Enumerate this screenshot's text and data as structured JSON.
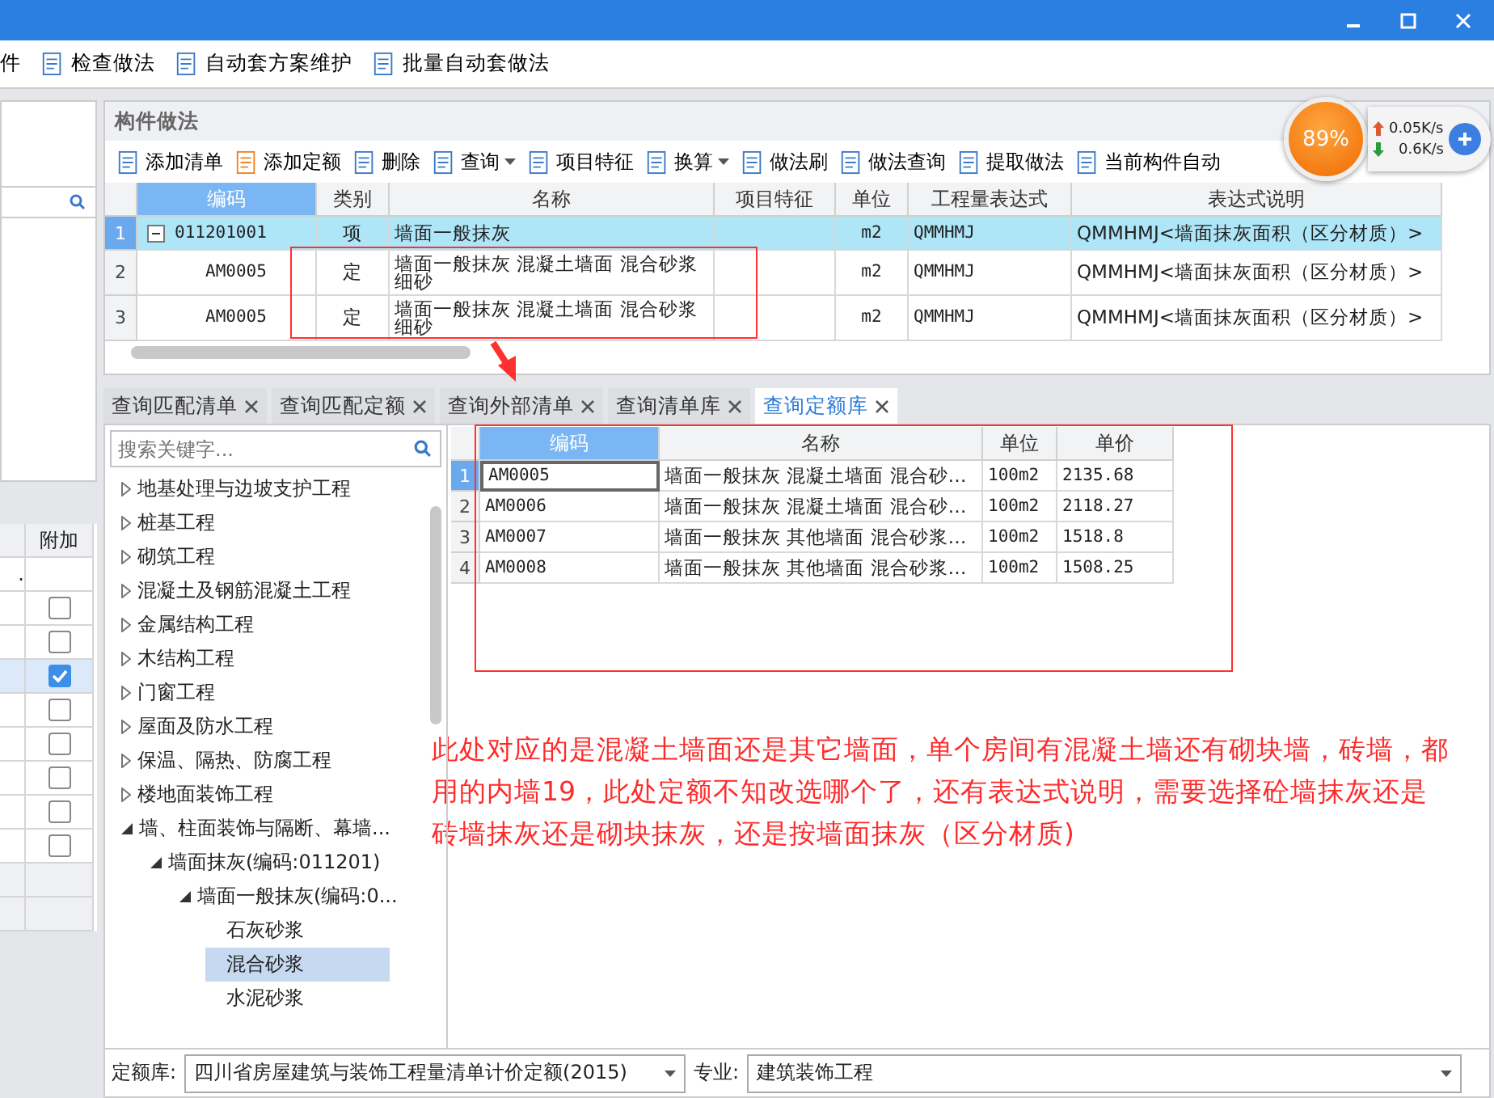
{
  "toolbar": {
    "cut_label": "件",
    "buttons": [
      "检查做法",
      "自动套方案维护",
      "批量自动套做法"
    ]
  },
  "left_panel": {
    "column": "附加",
    "rows": [
      {
        "kind": "text",
        "text": "."
      },
      {
        "kind": "checkbox",
        "checked": false
      },
      {
        "kind": "checkbox",
        "checked": false
      },
      {
        "kind": "checkbox",
        "checked": true
      },
      {
        "kind": "checkbox",
        "checked": false
      },
      {
        "kind": "checkbox",
        "checked": false
      },
      {
        "kind": "checkbox",
        "checked": false
      },
      {
        "kind": "checkbox",
        "checked": false
      },
      {
        "kind": "checkbox",
        "checked": false
      },
      {
        "kind": "blank"
      },
      {
        "kind": "blank"
      }
    ]
  },
  "method_panel": {
    "title": "构件做法",
    "toolbar": [
      {
        "label": "添加清单",
        "dropdown": false
      },
      {
        "label": "添加定额",
        "dropdown": false
      },
      {
        "label": "删除",
        "dropdown": false
      },
      {
        "label": "查询",
        "dropdown": true
      },
      {
        "label": "项目特征",
        "dropdown": false
      },
      {
        "label": "换算",
        "dropdown": true
      },
      {
        "label": "做法刷",
        "dropdown": false
      },
      {
        "label": "做法查询",
        "dropdown": false
      },
      {
        "label": "提取做法",
        "dropdown": false
      },
      {
        "label": "当前构件自动",
        "dropdown": false
      }
    ],
    "columns": [
      "编码",
      "类别",
      "名称",
      "项目特征",
      "单位",
      "工程量表达式",
      "表达式说明"
    ],
    "rows": [
      {
        "number": "1",
        "code": "011201001",
        "type": "项",
        "name": "墙面一般抹灰",
        "unit": "m2",
        "expression": "QMMHMJ",
        "description": "QMMHMJ<墙面抹灰面积（区分材质）>",
        "selected": true,
        "expanded": true,
        "children": [
          {
            "number": "2",
            "code": "AM0005",
            "type": "定",
            "name": "墙面一般抹灰 混凝土墙面 混合砂浆细砂",
            "unit": "m2",
            "expression": "QMMHMJ",
            "description": "QMMHMJ<墙面抹灰面积（区分材质）>",
            "selected": false
          },
          {
            "number": "3",
            "code": "AM0005",
            "type": "定",
            "name": "墙面一般抹灰 混凝土墙面 混合砂浆细砂",
            "unit": "m2",
            "expression": "QMMHMJ",
            "description": "QMMHMJ<墙面抹灰面积（区分材质）>",
            "selected": false
          }
        ]
      }
    ]
  },
  "tabs": [
    {
      "label": "查询匹配清单",
      "selected": false
    },
    {
      "label": "查询匹配定额",
      "selected": false
    },
    {
      "label": "查询外部清单",
      "selected": false
    },
    {
      "label": "查询清单库",
      "selected": false
    },
    {
      "label": "查询定额库",
      "selected": true
    }
  ],
  "library_tree": {
    "search": {
      "placeholder": "搜索关键字..."
    },
    "items": [
      {
        "label": "地基处理与边坡支护工程",
        "expanded": false,
        "selected": false
      },
      {
        "label": "桩基工程",
        "expanded": false,
        "selected": false
      },
      {
        "label": "砌筑工程",
        "expanded": false,
        "selected": false
      },
      {
        "label": "混凝土及钢筋混凝土工程",
        "expanded": false,
        "selected": false
      },
      {
        "label": "金属结构工程",
        "expanded": false,
        "selected": false
      },
      {
        "label": "木结构工程",
        "expanded": false,
        "selected": false
      },
      {
        "label": "门窗工程",
        "expanded": false,
        "selected": false
      },
      {
        "label": "屋面及防水工程",
        "expanded": false,
        "selected": false
      },
      {
        "label": "保温、隔热、防腐工程",
        "expanded": false,
        "selected": false
      },
      {
        "label": "楼地面装饰工程",
        "expanded": false,
        "selected": false
      },
      {
        "label": "墙、柱面装饰与隔断、幕墙...",
        "expanded": true,
        "selected": false,
        "children": [
          {
            "label": "墙面抹灰(编码:011201)",
            "expanded": true,
            "selected": false,
            "children": [
              {
                "label": "墙面一般抹灰(编码:0...",
                "expanded": true,
                "selected": false,
                "children": [
                  {
                    "label": "石灰砂浆",
                    "selected": false
                  },
                  {
                    "label": "混合砂浆",
                    "selected": true
                  },
                  {
                    "label": "水泥砂浆",
                    "selected": false
                  }
                ]
              }
            ]
          }
        ]
      }
    ]
  },
  "quota_table": {
    "columns": [
      "编码",
      "名称",
      "单位",
      "单价"
    ],
    "rows": [
      {
        "number": "1",
        "code": "AM0005",
        "name": "墙面一般抹灰 混凝土墙面 混合砂…",
        "unit": "100m2",
        "price": "2135.68",
        "selected": true
      },
      {
        "number": "2",
        "code": "AM0006",
        "name": "墙面一般抹灰 混凝土墙面 混合砂…",
        "unit": "100m2",
        "price": "2118.27",
        "selected": false
      },
      {
        "number": "3",
        "code": "AM0007",
        "name": "墙面一般抹灰 其他墙面 混合砂浆…",
        "unit": "100m2",
        "price": "1518.8",
        "selected": false
      },
      {
        "number": "4",
        "code": "AM0008",
        "name": "墙面一般抹灰 其他墙面 混合砂浆…",
        "unit": "100m2",
        "price": "1508.25",
        "selected": false
      }
    ]
  },
  "note": "此处对应的是混凝土墙面还是其它墙面，单个房间有混凝土墙还有砌块墙，砖墙，都用的内墙19，此处定额不知改选哪个了，还有表达式说明，需要选择砼墙抹灰还是砖墙抹灰还是砌块抹灰，还是按墙面抹灰（区分材质)",
  "footer": {
    "library_label": "定额库:",
    "library_value": "四川省房屋建筑与装饰工程量清单计价定额(2015)",
    "major_label": "专业:",
    "major_value": "建筑装饰工程"
  },
  "speed_widget": {
    "percent": "89%",
    "upload": "0.05K/s",
    "download": "0.6K/s"
  }
}
